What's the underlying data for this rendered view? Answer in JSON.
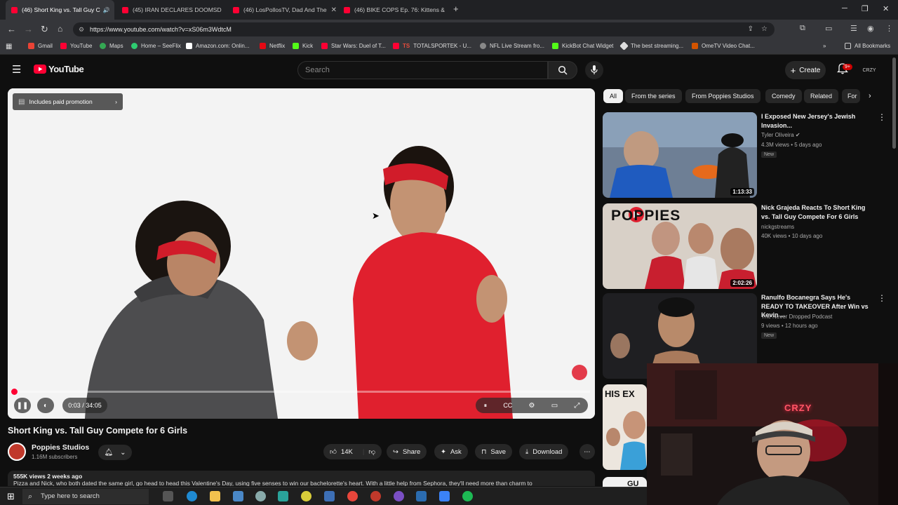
{
  "browser": {
    "tabs": [
      {
        "label": "(46) Short King vs. Tall Guy C",
        "active": true
      },
      {
        "label": "(45) IRAN DECLARES DOOMSD",
        "active": false
      },
      {
        "label": "(46) LosPollosTV, Dad And The",
        "active": false
      },
      {
        "label": "(46) BIKE COPS Ep. 76: Kittens &",
        "active": false
      }
    ],
    "url": "https://www.youtube.com/watch?v=xS06m3WdtcM",
    "bookmarks": [
      "Gmail",
      "YouTube",
      "Maps",
      "Home – SeeFlix",
      "Amazon.com: Onlin...",
      "Netflix",
      "Kick",
      "Star Wars: Duel of T...",
      "TOTALSPORTEK - U...",
      "NFL Live Stream fro...",
      "KickBot Chat Widget",
      "The best streaming...",
      "OmeTV Video Chat..."
    ],
    "all_bookmarks": "All Bookmarks"
  },
  "youtube": {
    "logo": "YouTube",
    "search_placeholder": "Search",
    "create_label": "Create",
    "notif_badge": "9+",
    "account_label": "CRZY"
  },
  "player": {
    "promo": "Includes paid promotion",
    "time": "0:03 / 34:05",
    "progress_fraction": 0.0015
  },
  "video": {
    "title": "Short King vs. Tall Guy Compete for 6 Girls",
    "channel": "Poppies Studios",
    "subscribers": "1.16M subscribers",
    "likes": "14K",
    "share": "Share",
    "ask": "Ask",
    "save": "Save",
    "download": "Download",
    "views_date": "555K views  2 weeks ago",
    "description": "Pizza and Nick, who both dated the same girl, go head to head this Valentine's Day, using five senses to win our bachelorette's heart. With a little help from Sephora, they'll need more than charm to"
  },
  "chips": [
    "All",
    "From the series",
    "From Poppies Studios",
    "Comedy",
    "Related",
    "For"
  ],
  "recommendations": [
    {
      "title": "I Exposed New Jersey's Jewish Invasion...",
      "channel": "Tyler Oliveira",
      "meta": "4.3M views • 5 days ago",
      "badge": "New",
      "duration": "1:13:33",
      "thumb_color": "#6b7a8c"
    },
    {
      "title": "Nick Grajeda Reacts To Short King vs. Tall Guy Compete For 6 Girls",
      "channel": "nickgstreams",
      "meta": "40K views • 10 days ago",
      "badge": "",
      "duration": "2:02:26",
      "thumb_color": "#c9c2bb",
      "thumb_text": "POPPIES"
    },
    {
      "title": "Ranulfo Bocanegra Says He's READY TO TAKEOVER After Win vs Kevin ...",
      "channel": "The Never Dropped Podcast",
      "meta": "9 views • 12 hours ago",
      "badge": "New",
      "duration": "",
      "thumb_color": "#2a2a2a"
    },
    {
      "title": "",
      "channel": "",
      "meta": "",
      "badge": "",
      "duration": "",
      "thumb_color": "#e8e1d8",
      "thumb_text": "HIS EX"
    }
  ],
  "webcam": {
    "neon": "CRZY"
  },
  "taskbar": {
    "search_placeholder": "Type here to search"
  },
  "colors": {
    "brand_red": "#ff0033",
    "bg": "#0f0f0f",
    "chip": "#272727"
  }
}
